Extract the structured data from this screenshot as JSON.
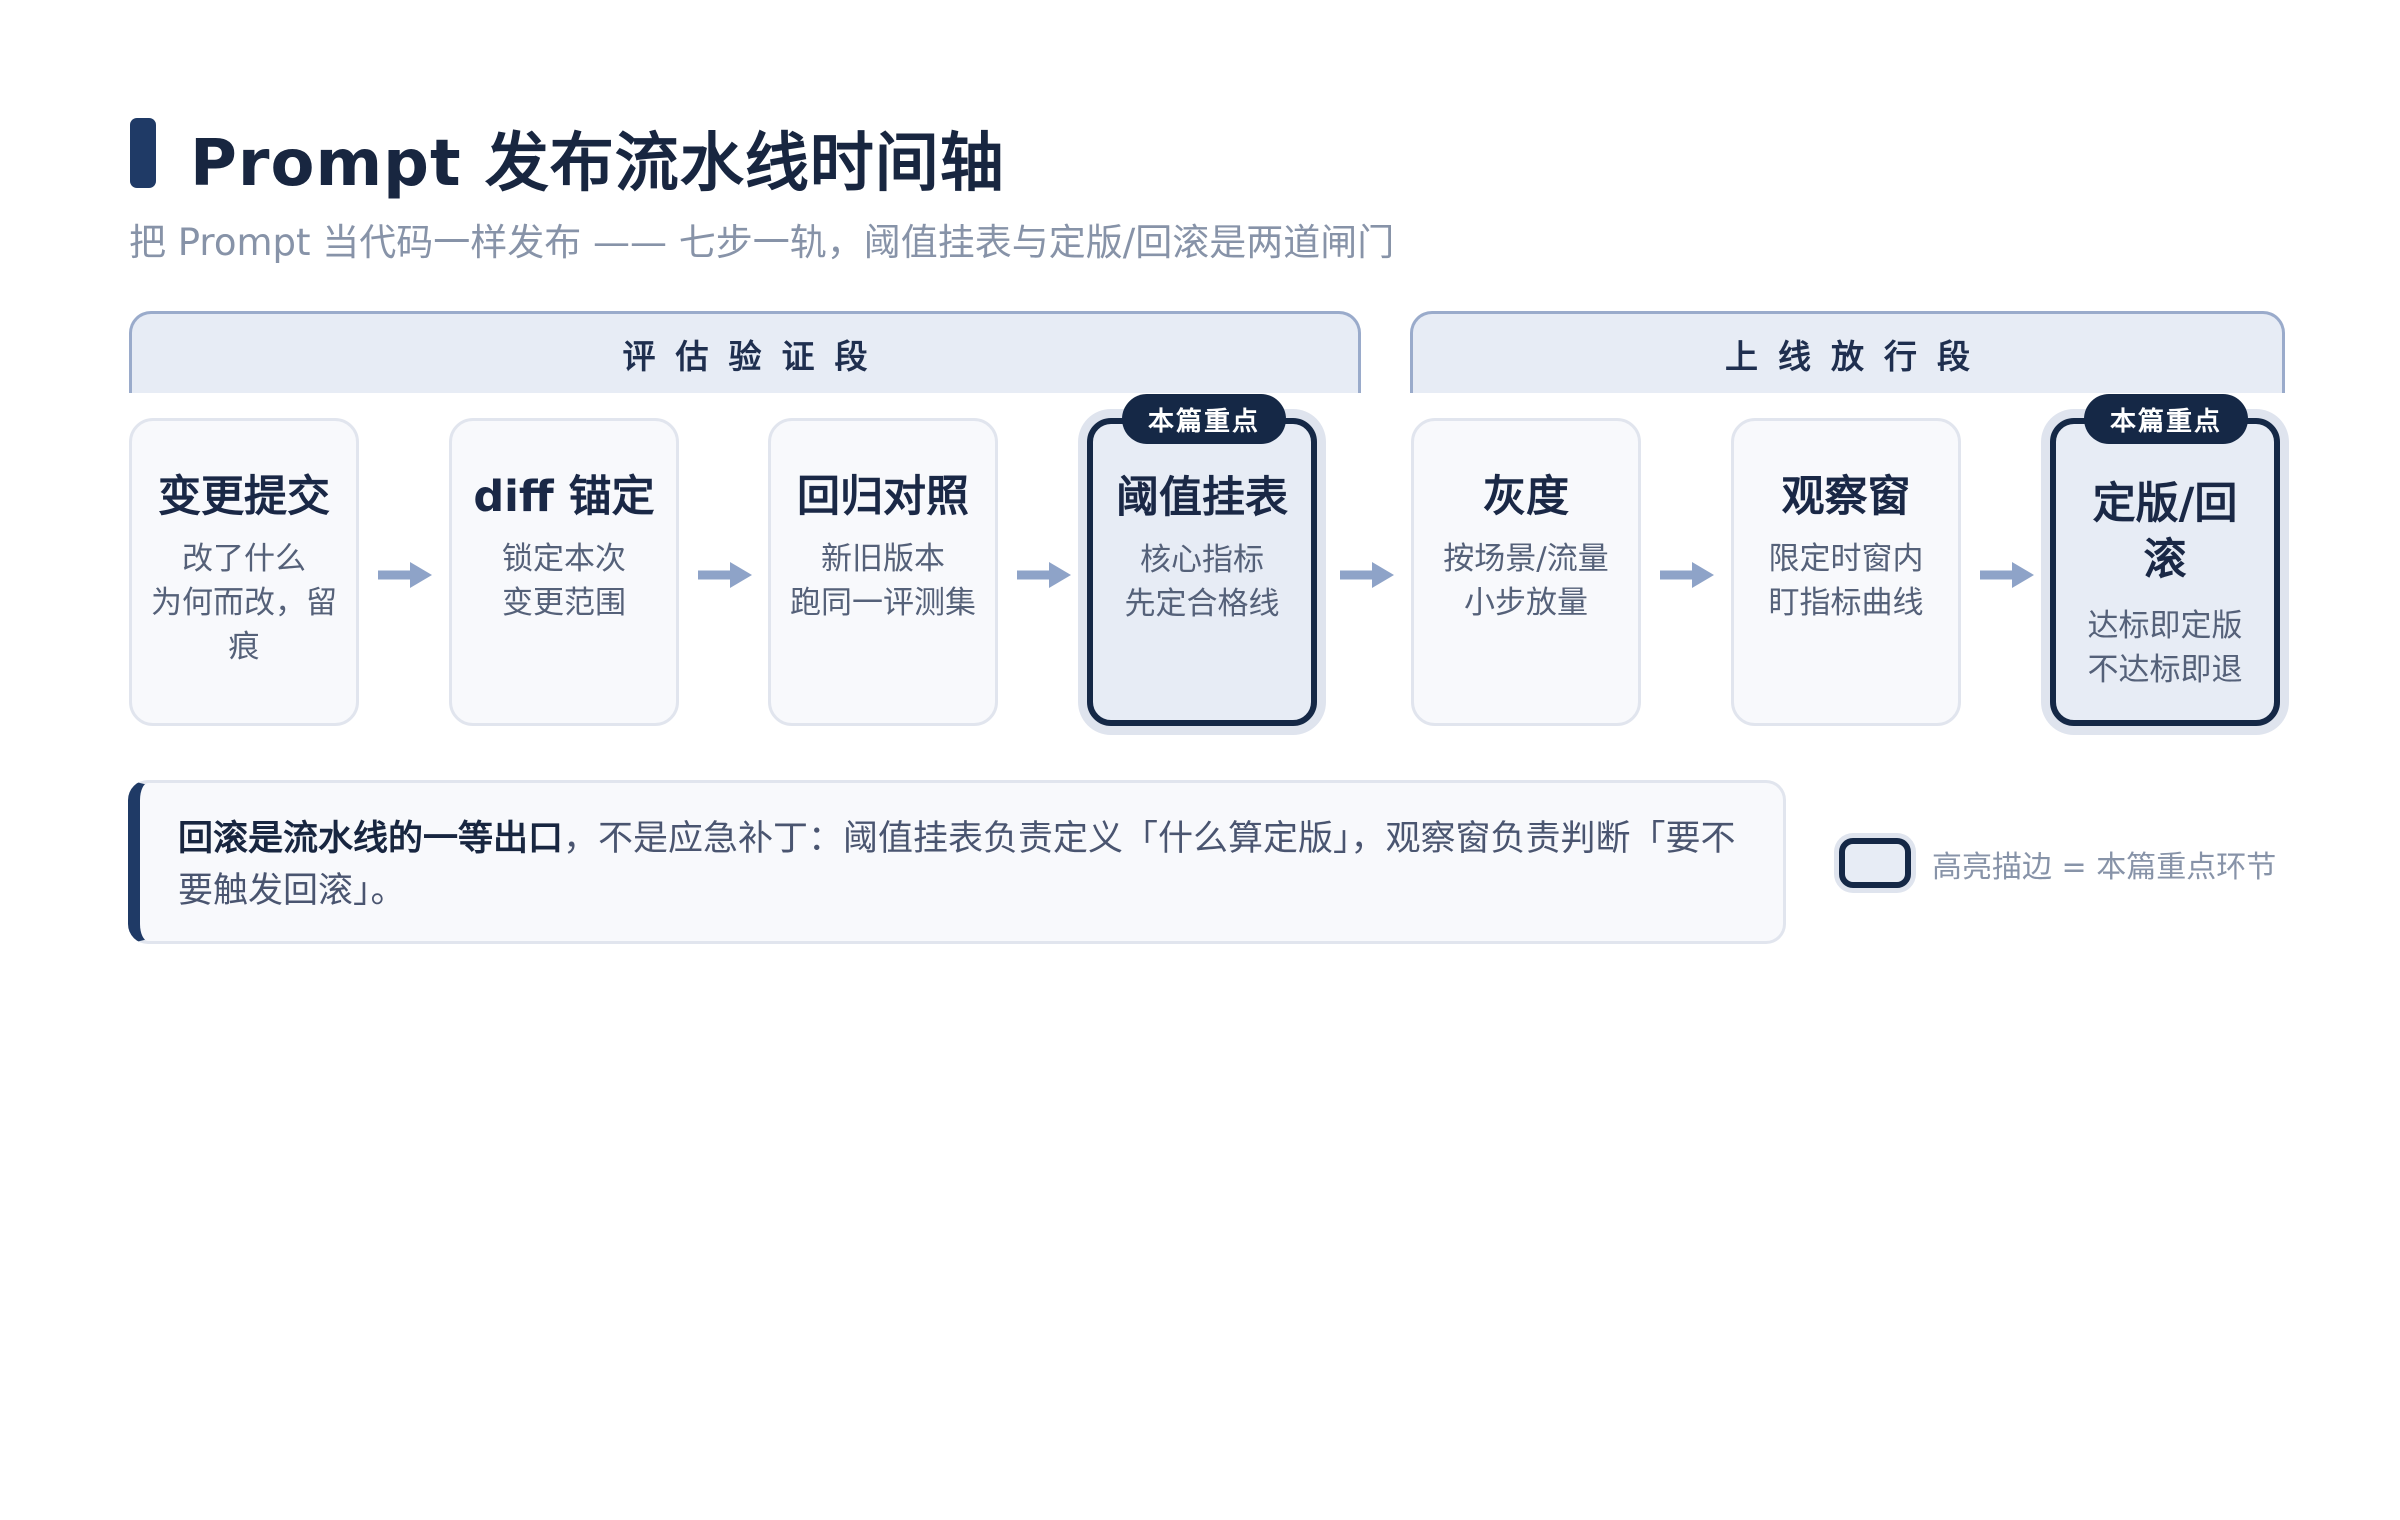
{
  "header": {
    "title": "Prompt 发布流水线时间轴",
    "subtitle": "把 Prompt 当代码一样发布 —— 七步一轨，阈值挂表与定版/回滚是两道闸门"
  },
  "phases": [
    {
      "label": "评估验证段"
    },
    {
      "label": "上线放行段"
    }
  ],
  "badge_label": "本篇重点",
  "steps": [
    {
      "title": "变更提交",
      "desc": "改了什么\n为何而改，留\n痕",
      "highlight": false
    },
    {
      "title": "diff 锚定",
      "desc": "锁定本次\n变更范围",
      "highlight": false
    },
    {
      "title": "回归对照",
      "desc": "新旧版本\n跑同一评测集",
      "highlight": false
    },
    {
      "title": "阈值挂表",
      "desc": "核心指标\n先定合格线",
      "highlight": true
    },
    {
      "title": "灰度",
      "desc": "按场景/流量\n小步放量",
      "highlight": false
    },
    {
      "title": "观察窗",
      "desc": "限定时窗内\n盯指标曲线",
      "highlight": false
    },
    {
      "title": "定版/回\n滚",
      "desc": "达标即定版\n不达标即退",
      "highlight": true
    }
  ],
  "note": {
    "strong": "回滚是流水线的一等出口",
    "text": "，不是应急补丁：阈值挂表负责定义「什么算定版」，观察窗负责判断「要不要触发回滚」。"
  },
  "legend": {
    "label": "高亮描边 = 本篇重点环节"
  },
  "colors": {
    "accent": "#152846",
    "phase_fill": "#e7ecf5",
    "arrow": "#8ea3c8",
    "card_fill": "#f8f9fc"
  }
}
